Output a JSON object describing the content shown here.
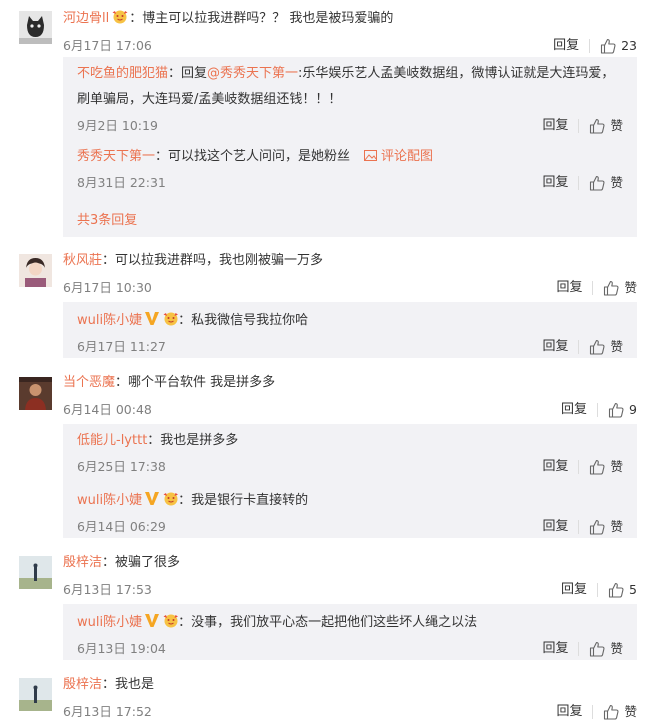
{
  "labels": {
    "reply": "回复",
    "like_zan": "赞"
  },
  "c1": {
    "name": "河边骨ll",
    "text": "：博主可以拉我进群吗？？ 我也是被玛爱骗的",
    "time": "6月17日 17:06",
    "likes": "23"
  },
  "r1a": {
    "name": "不吃鱼的肥犯猫",
    "prefix": "：回复",
    "at": "@秀秀天下第一",
    "text1": ":乐华娱乐艺人孟美岐数据组，微博认证就是大连玛爱，",
    "text2": "刷单骗局，大连玛爱/孟美岐数据组还钱！！！",
    "time": "9月2日 10:19"
  },
  "r1b": {
    "name": "秀秀天下第一",
    "text": "：可以找这个艺人问问，是她粉丝",
    "pic": "评论配图",
    "time": "8月31日 22:31"
  },
  "r1more": "共3条回复",
  "c2": {
    "name": "秋风莊",
    "text": "：可以拉我进群吗，我也刚被骗一万多",
    "time": "6月17日 10:30"
  },
  "r2a": {
    "name": "wuli陈小婕",
    "text": "：私我微信号我拉你哈",
    "time": "6月17日 11:27"
  },
  "c3": {
    "name": "当个恶魔",
    "text": "：哪个平台软件   我是拼多多",
    "time": "6月14日 00:48",
    "likes": "9"
  },
  "r3a": {
    "name": "低能儿-lyttt",
    "text": "：我也是拼多多",
    "time": "6月25日 17:38"
  },
  "r3b": {
    "name": "wuli陈小婕",
    "text": "：我是银行卡直接转的",
    "time": "6月14日 06:29"
  },
  "c4": {
    "name": "殷梓洁",
    "text": "：被骗了很多",
    "time": "6月13日 17:53",
    "likes": "5"
  },
  "r4a": {
    "name": "wuli陈小婕",
    "text": "：没事，我们放平心态一起把他们这些坏人绳之以法",
    "time": "6月13日 19:04"
  },
  "c5": {
    "name": "殷梓洁",
    "text": "：我也是",
    "time": "6月13日 17:52"
  },
  "colors": {
    "link": "#eb7350",
    "reply_bg": "#f2f2f5",
    "text": "#333333",
    "meta": "#808080"
  }
}
